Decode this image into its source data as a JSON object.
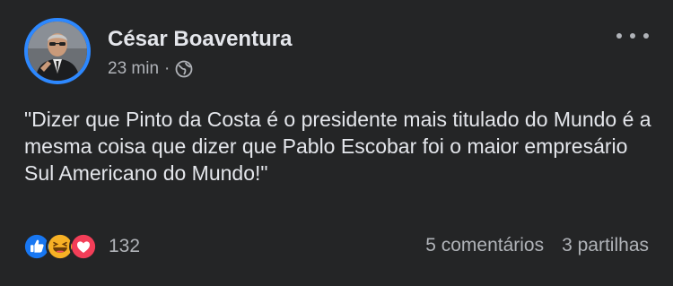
{
  "post": {
    "author": "César Boaventura",
    "time": "23 min",
    "separator": "·",
    "privacy_icon": "globe-icon",
    "menu_icon": "more-options-icon",
    "text": "\"Dizer que Pinto da Costa é o presidente mais titulado do Mundo é a mesma coisa que dizer que Pablo Escobar foi o maior empresário Sul Americano do Mundo!\""
  },
  "reactions": {
    "types": [
      "like-icon",
      "haha-icon",
      "love-icon"
    ],
    "count": "132"
  },
  "stats": {
    "comments": "5 comentários",
    "shares": "3 partilhas"
  },
  "colors": {
    "background": "#242526",
    "text": "#e4e6eb",
    "secondary_text": "#b0b3b8",
    "avatar_ring": "#2d88ff",
    "like": "#1877f2",
    "love": "#f33e58",
    "haha": "#f7b125"
  }
}
